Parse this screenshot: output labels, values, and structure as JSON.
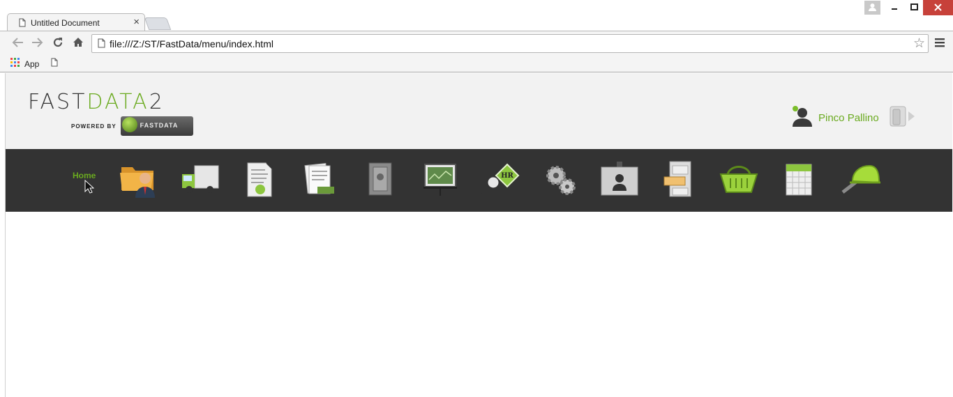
{
  "browser": {
    "tab_title": "Untitled Document",
    "tab_close": "×",
    "url": "file:///Z:/ST/FastData/menu/index.html",
    "bookmarks": {
      "apps_label": "App"
    }
  },
  "site": {
    "logo": {
      "part1": "FAST",
      "part2": "DATA",
      "part3": "2",
      "powered_by": "POWERED BY",
      "badge_text": "FASTDATA"
    },
    "user": {
      "name": "Pinco Pallino"
    },
    "nav": {
      "home_label": "Home",
      "items": [
        "folder-user-icon",
        "delivery-truck-icon",
        "certificate-document-icon",
        "documents-money-icon",
        "safe-icon",
        "presentation-board-icon",
        "hr-search-icon",
        "gears-icon",
        "id-badge-icon",
        "filing-cabinet-icon",
        "shopping-basket-icon",
        "calendar-icon",
        "helmet-wrench-icon"
      ]
    },
    "colors": {
      "accent": "#6aaa1f",
      "navbar": "#333333",
      "header": "#f2f2f2"
    }
  }
}
